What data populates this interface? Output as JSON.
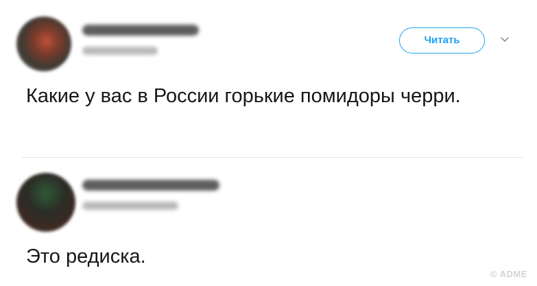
{
  "main_tweet": {
    "follow_label": "Читать",
    "text": "Какие у вас в России горькие помидоры черри."
  },
  "reply_tweet": {
    "text": "Это редиска."
  },
  "watermark": "© ADME",
  "icons": {
    "menu": "chevron-down-icon"
  },
  "colors": {
    "accent": "#1da1f2",
    "text": "#14171a",
    "divider": "#dce4ea"
  }
}
